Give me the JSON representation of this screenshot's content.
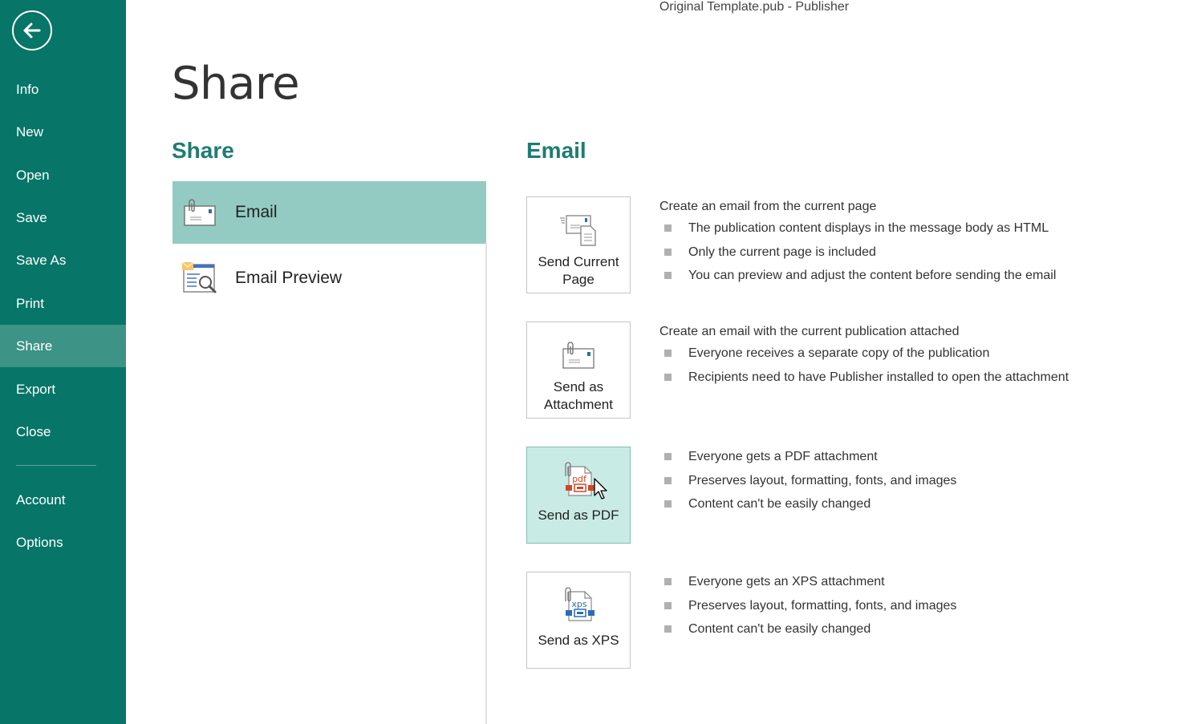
{
  "window": {
    "title": "Original Template.pub - Publisher"
  },
  "sidebar": {
    "back_icon": "back-arrow-icon",
    "items": [
      {
        "label": "Info",
        "active": false
      },
      {
        "label": "New",
        "active": false
      },
      {
        "label": "Open",
        "active": false
      },
      {
        "label": "Save",
        "active": false
      },
      {
        "label": "Save As",
        "active": false
      },
      {
        "label": "Print",
        "active": false
      },
      {
        "label": "Share",
        "active": true
      },
      {
        "label": "Export",
        "active": false
      },
      {
        "label": "Close",
        "active": false
      }
    ],
    "bottom_items": [
      {
        "label": "Account"
      },
      {
        "label": "Options"
      }
    ],
    "colors": {
      "background": "#077568",
      "active": "#3d9386"
    }
  },
  "main": {
    "page_title": "Share",
    "share_section": {
      "title": "Share",
      "items": [
        {
          "label": "Email",
          "icon": "email-attachment-icon",
          "selected": true
        },
        {
          "label": "Email Preview",
          "icon": "email-preview-icon",
          "selected": false
        }
      ]
    },
    "email_section": {
      "title": "Email",
      "options": [
        {
          "label": "Send Current Page",
          "icon": "send-current-page-icon",
          "heading": "Create an email from the current page",
          "bullets": [
            "The publication content displays in the message body as HTML",
            "Only the current page is included",
            "You can preview and adjust the content before sending the email"
          ]
        },
        {
          "label": "Send as Attachment",
          "icon": "send-attachment-icon",
          "heading": "Create an email with the current publication attached",
          "bullets": [
            "Everyone receives a separate copy of the publication",
            "Recipients need to have Publisher installed to open the attachment"
          ]
        },
        {
          "label": "Send as PDF",
          "icon": "pdf-icon",
          "icon_text": "pdf",
          "hovered": true,
          "heading": "",
          "bullets": [
            "Everyone gets a PDF attachment",
            "Preserves layout, formatting, fonts, and images",
            "Content can't be easily changed"
          ]
        },
        {
          "label": "Send as XPS",
          "icon": "xps-icon",
          "icon_text": "xps",
          "heading": "",
          "bullets": [
            "Everyone gets an XPS attachment",
            "Preserves layout, formatting, fonts, and images",
            "Content can't be easily changed"
          ]
        }
      ]
    },
    "colors": {
      "accent": "#1f7c70",
      "selected": "#93cbc2",
      "hover": "#c9ebe5",
      "pdf": "#d24726",
      "xps": "#2b6cb5"
    }
  }
}
